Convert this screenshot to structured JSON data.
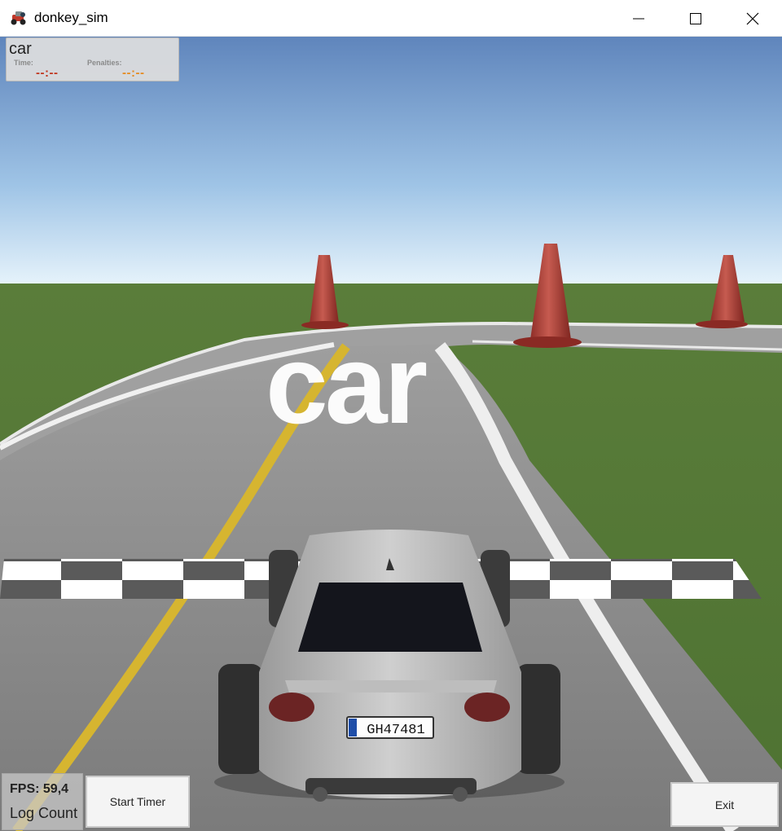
{
  "window": {
    "title": "donkey_sim",
    "app_icon": "donkey-car-icon"
  },
  "hud": {
    "car_name": "car",
    "time_label": "Time:",
    "time_value": "--:--",
    "penalties_label": "Penalties:",
    "penalties_value": "--:--",
    "time_color": "#c0341d",
    "penalties_color": "#e58a1f"
  },
  "scene": {
    "car_label": "car",
    "license_plate": "GH47481"
  },
  "stats": {
    "fps": "FPS: 59,4",
    "log_count": "Log Count"
  },
  "buttons": {
    "start_timer": "Start Timer",
    "exit": "Exit"
  }
}
